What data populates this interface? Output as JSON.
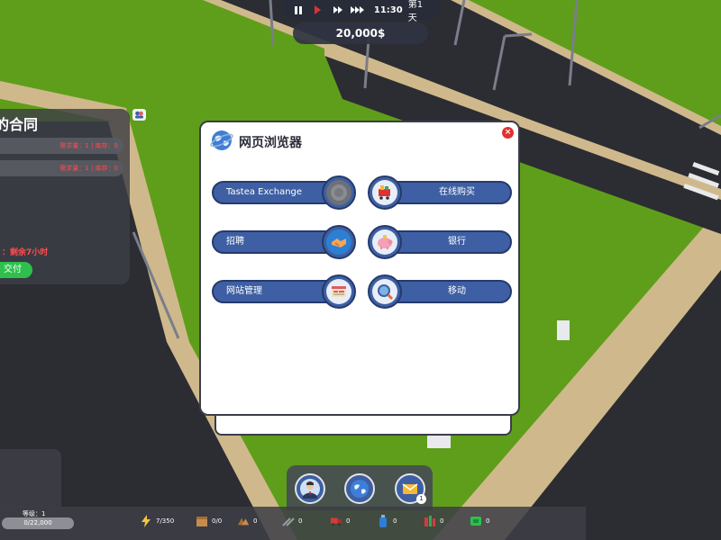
{
  "timebar": {
    "time": "11:30",
    "day": "第1天"
  },
  "money": "20,000$",
  "contract": {
    "title": "的合同",
    "rows": [
      "需求量：1 | 库存：0",
      "需求量：1 | 库存：0"
    ],
    "remaining": "：剩余7小时",
    "pay_label": "交付"
  },
  "browser": {
    "title": "网页浏览器",
    "apps": [
      {
        "label": "Tastea Exchange",
        "icon": "exchange-icon"
      },
      {
        "label": "在线购买",
        "icon": "shopping-cart-icon"
      },
      {
        "label": "招聘",
        "icon": "handshake-icon"
      },
      {
        "label": "银行",
        "icon": "piggy-bank-icon"
      },
      {
        "label": "网站管理",
        "icon": "website-icon"
      },
      {
        "label": "移动",
        "icon": "search-icon"
      }
    ]
  },
  "dock": {
    "buttons": [
      {
        "icon": "manager-avatar-icon"
      },
      {
        "icon": "globe-icon"
      },
      {
        "icon": "mail-icon",
        "badge": "1"
      }
    ]
  },
  "status": {
    "level": "等级：1",
    "xp": "0/22,000",
    "xp_fraction": 0,
    "energy": "7/350",
    "stats": [
      "0/0",
      "0",
      "0",
      "0",
      "0",
      "0",
      "0"
    ]
  },
  "colors": {
    "button_blue": "#3e5fa3",
    "close_red": "#e03131",
    "pay_green": "#2ec04d",
    "warning_red": "#ff4c4c"
  }
}
